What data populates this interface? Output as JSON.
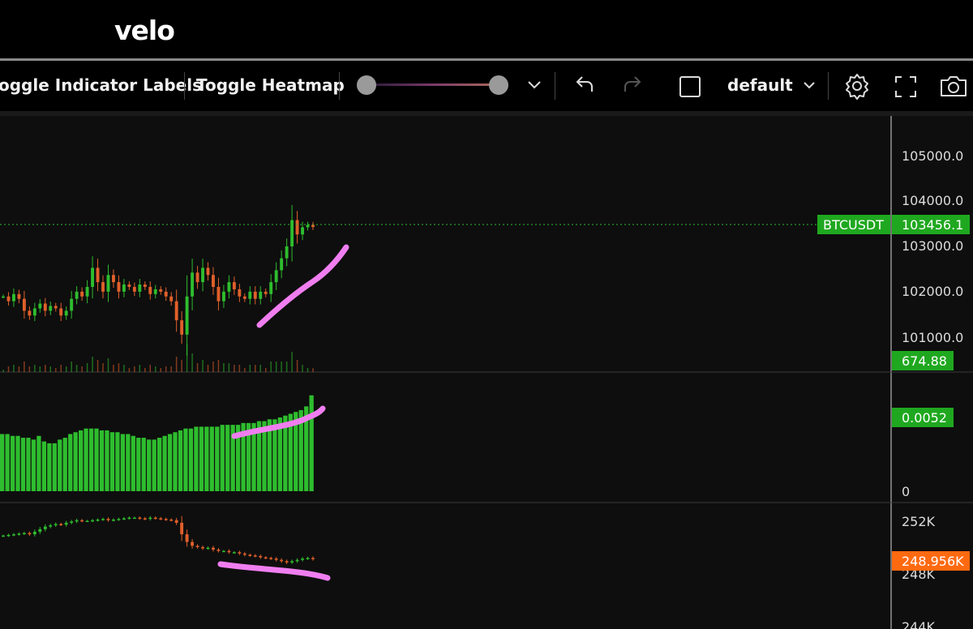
{
  "app": {
    "logo": "velo"
  },
  "toolbar": {
    "toggle_indicator_labels": "oggle Indicator Labels",
    "toggle_heatmap": "Toggle Heatmap",
    "layout_name": "default",
    "icons": [
      "chevron-down-icon",
      "undo-icon",
      "redo-icon",
      "checkbox-icon",
      "chevron-down-icon",
      "gear-icon",
      "fullscreen-icon",
      "camera-icon"
    ]
  },
  "colors": {
    "up": "#2ebd2e",
    "down": "#e0602a",
    "price_tag": "#1fa81f",
    "oi_tag": "#ff6a10",
    "annotation": "#f07ef0"
  },
  "chart_data": [
    {
      "type": "candlestick",
      "panel": "price",
      "symbol": "BTCUSDT",
      "last_price_label": "103456.1",
      "volume_label": "674.88",
      "y_ticks": [
        "105000.0",
        "104000.0",
        "103000.0",
        "102000.0",
        "101000.0"
      ],
      "ylim": [
        100500,
        105700
      ],
      "points": [
        102000,
        101900,
        102050,
        101950,
        101700,
        101600,
        101750,
        101850,
        101700,
        101800,
        101750,
        101600,
        101700,
        101950,
        102100,
        102000,
        102200,
        102600,
        102300,
        102100,
        102450,
        102300,
        102100,
        102250,
        102200,
        102100,
        102250,
        102200,
        102050,
        102150,
        102100,
        102000,
        101900,
        101500,
        101200,
        102000,
        102500,
        102300,
        102600,
        102450,
        102200,
        101900,
        102100,
        102300,
        102150,
        102000,
        101950,
        102100,
        101950,
        102100,
        102050,
        102300,
        102550,
        102800,
        103050,
        103600,
        103300,
        103450,
        103500,
        103456.1
      ]
    },
    {
      "type": "bar",
      "panel": "indicator",
      "last_value_label": "0.0052",
      "y_ticks": [
        "0"
      ],
      "ylim": [
        0,
        0.0062
      ],
      "values": [
        0.0031,
        0.0031,
        0.003,
        0.003,
        0.0029,
        0.0029,
        0.0028,
        0.003,
        0.0027,
        0.0026,
        0.0026,
        0.0028,
        0.0029,
        0.0031,
        0.0032,
        0.0033,
        0.0034,
        0.0034,
        0.0034,
        0.0033,
        0.0033,
        0.0032,
        0.0032,
        0.0031,
        0.0031,
        0.003,
        0.0029,
        0.0029,
        0.0028,
        0.0028,
        0.0029,
        0.003,
        0.0031,
        0.0032,
        0.0033,
        0.0034,
        0.0034,
        0.0035,
        0.0035,
        0.0035,
        0.0035,
        0.0035,
        0.0036,
        0.0036,
        0.0036,
        0.0036,
        0.0037,
        0.0037,
        0.0037,
        0.0038,
        0.0038,
        0.0039,
        0.0039,
        0.004,
        0.0041,
        0.0042,
        0.0043,
        0.0044,
        0.0046,
        0.0052
      ]
    },
    {
      "type": "candlestick",
      "panel": "open_interest",
      "last_value_label": "248.956K",
      "y_ticks": [
        "252K",
        "248K",
        "244K"
      ],
      "ylim": [
        243500,
        253000
      ],
      "points": [
        250800,
        250850,
        250900,
        250950,
        251000,
        250900,
        251100,
        251300,
        251500,
        251600,
        251700,
        251650,
        251800,
        251900,
        252000,
        251950,
        251950,
        252000,
        252050,
        252100,
        252000,
        252050,
        252100,
        252150,
        252200,
        252200,
        252150,
        252100,
        252200,
        252150,
        252100,
        252050,
        252000,
        251800,
        250900,
        250300,
        250000,
        249900,
        249800,
        249850,
        249700,
        249600,
        249600,
        249500,
        249500,
        249400,
        249300,
        249250,
        249200,
        249100,
        249050,
        249000,
        248900,
        248800,
        248700,
        248800,
        248900,
        249000,
        249050,
        248956
      ]
    }
  ]
}
